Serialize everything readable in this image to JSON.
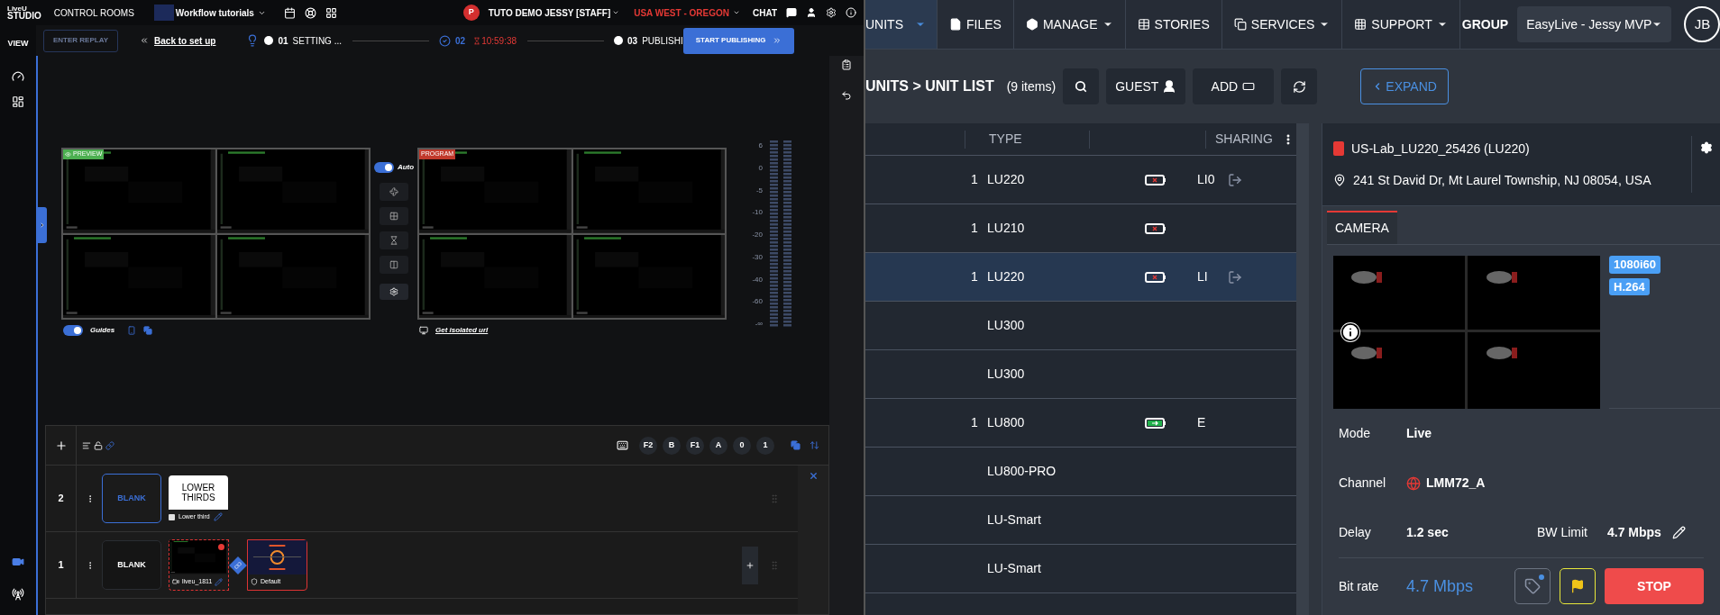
{
  "studio": {
    "topbar": {
      "logo_small": "LiveU",
      "logo": "STUDIO",
      "control_rooms": "CONTROL ROOMS",
      "workflow": "Workflow tutorials",
      "user_initial": "P",
      "user": "TUTO DEMO JESSY [STAFF]",
      "region": "USA WEST - OREGON",
      "chat": "CHAT"
    },
    "sidebar": {
      "view": "VIEW"
    },
    "steps": {
      "replay": {
        "label": "ENTER REPLAY",
        "disabled": true
      },
      "back": "Back to set up",
      "items": [
        {
          "number": "01",
          "label": "SETTING ...",
          "done": false
        },
        {
          "number": "02",
          "timer": "10:59:38",
          "done": true
        },
        {
          "number": "03",
          "label": "PUBLISHI",
          "done": false
        }
      ],
      "publish": "START PUBLISHING"
    },
    "preview": {
      "label": "PREVIEW",
      "guides": {
        "label": "Guides",
        "on": true
      }
    },
    "auto": {
      "label": "Auto",
      "on": true
    },
    "program": {
      "label": "PROGRAM",
      "isolated": "Get isolated url"
    },
    "meter_scale": [
      "6",
      "0",
      "-5",
      "-10",
      "-20",
      "-30",
      "-40",
      "-60",
      "-∞"
    ],
    "layers": {
      "keys": [
        "F2",
        "B",
        "F1",
        "A",
        "0",
        "1"
      ],
      "rows": [
        {
          "number": "2",
          "blank": {
            "label": "BLANK",
            "selected": true
          },
          "items": [
            {
              "kind": "graphic",
              "title": "LOWER THIRDS",
              "caption": "Lower third"
            }
          ]
        },
        {
          "number": "1",
          "blank": {
            "label": "BLANK",
            "selected": false
          },
          "items": [
            {
              "kind": "video",
              "caption": "liveu_1811"
            },
            {
              "kind": "overlay",
              "caption": "Default"
            }
          ]
        }
      ]
    }
  },
  "units": {
    "nav": [
      {
        "label": "UNITS",
        "selected": true,
        "caret": true
      },
      {
        "label": "FILES",
        "selected": false,
        "caret": false
      },
      {
        "label": "MANAGE",
        "selected": false,
        "caret": true
      },
      {
        "label": "STORIES",
        "selected": false,
        "caret": false
      },
      {
        "label": "SERVICES",
        "selected": false,
        "caret": true
      },
      {
        "label": "SUPPORT",
        "selected": false,
        "caret": true
      }
    ],
    "group_label": "GROUP",
    "group": "EasyLive - Jessy MVP",
    "avatar": "JB",
    "breadcrumb": "UNITS > UNIT LIST",
    "count": "(9 items)",
    "guest": "GUEST",
    "add": "ADD",
    "expand": "EXPAND",
    "columns": {
      "type": "TYPE",
      "sharing": "SHARING"
    },
    "rows": [
      {
        "column_2": "1",
        "type": "LU220",
        "battery": {
          "charging": false
        },
        "sharing": "LI0",
        "shared": true,
        "selected": false
      },
      {
        "column_2": "1",
        "type": "LU210",
        "battery": {
          "charging": false
        },
        "shared": false,
        "selected": false
      },
      {
        "column_2": "1",
        "type": "LU220",
        "battery": {
          "charging": false
        },
        "sharing": "LI",
        "shared": true,
        "selected": true
      },
      {
        "type": "LU300",
        "shared": false,
        "selected": false
      },
      {
        "type": "LU300",
        "shared": false,
        "selected": false
      },
      {
        "column_2": "1",
        "type": "LU800",
        "battery": {
          "charging": true
        },
        "sharing": "E",
        "shared": false,
        "selected": false
      },
      {
        "type": "LU800-PRO",
        "shared": false,
        "selected": false
      },
      {
        "type": "LU-Smart",
        "shared": false,
        "selected": false
      },
      {
        "type": "LU-Smart",
        "shared": false,
        "selected": false
      }
    ],
    "detail": {
      "title": "US-Lab_LU220_25426 (LU220)",
      "address": "241 St David Dr, Mt Laurel Township, NJ 08054, USA",
      "tabs": [
        {
          "label": "CAMERA",
          "selected": true
        }
      ],
      "badges": [
        "1080i60",
        "H.264"
      ],
      "mode_label": "Mode",
      "mode": "Live",
      "channel_label": "Channel",
      "channel": "LMM72_A",
      "delay_label": "Delay",
      "delay": "1.2 sec",
      "bw_label": "BW Limit",
      "bw": "4.7 Mbps",
      "bitrate_label": "Bit rate",
      "bitrate": "4.7 Mbps",
      "stop": "STOP"
    }
  }
}
